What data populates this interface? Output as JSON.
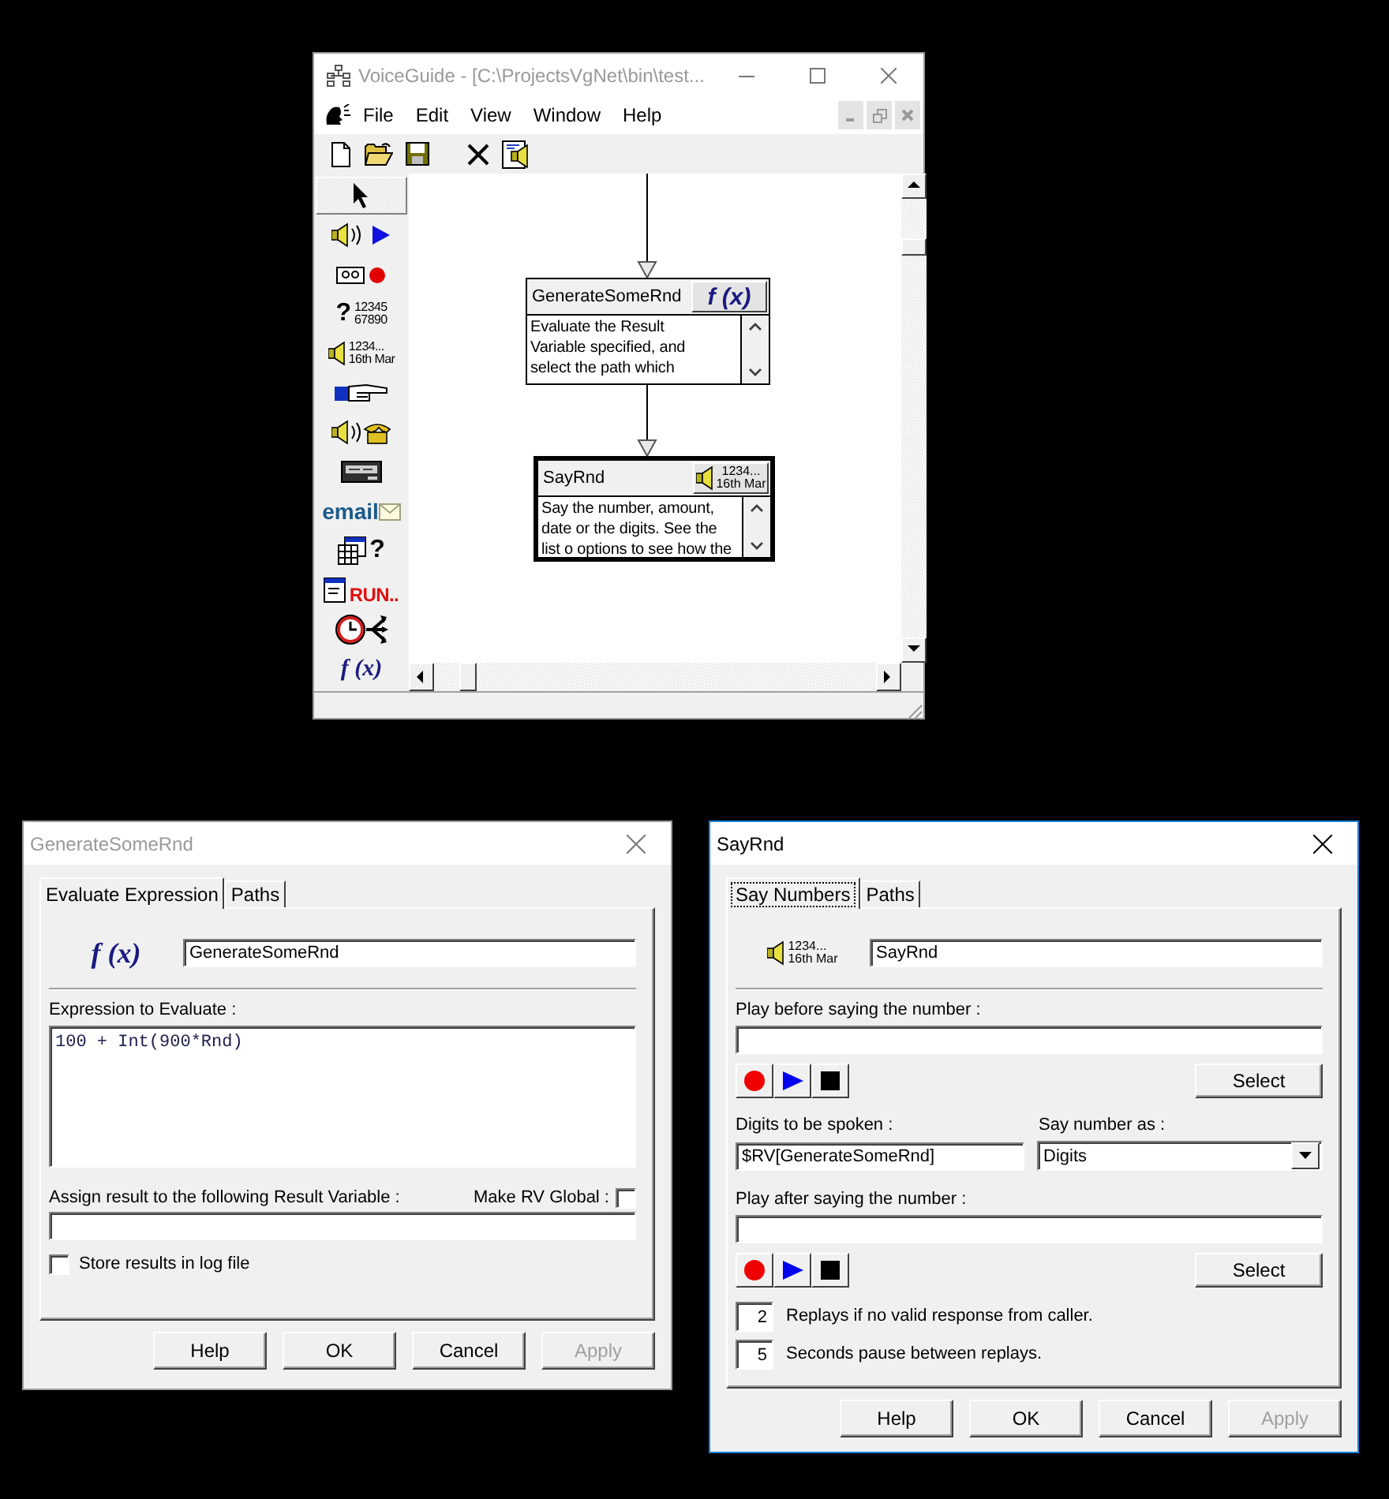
{
  "main_window": {
    "title": "VoiceGuide - [C:\\ProjectsVgNet\\bin\\test...",
    "active": false,
    "menu": [
      "File",
      "Edit",
      "View",
      "Window",
      "Help"
    ],
    "toolbar": [
      {
        "kind": "new"
      },
      {
        "kind": "open"
      },
      {
        "kind": "save"
      },
      {
        "kind": "delete"
      },
      {
        "kind": "properties"
      }
    ],
    "toolbox": [
      {
        "kind": "pointer",
        "selected": true
      },
      {
        "kind": "play",
        "selected": false
      },
      {
        "kind": "record",
        "selected": false
      },
      {
        "kind": "get_number",
        "symbol": "?",
        "lines": [
          "12345",
          "67890"
        ],
        "selected": false
      },
      {
        "kind": "say_number",
        "lines": [
          "1234...",
          "16th Mar"
        ],
        "selected": false
      },
      {
        "kind": "transfer",
        "selected": false
      },
      {
        "kind": "voicemail",
        "selected": false
      },
      {
        "kind": "pager",
        "selected": false
      },
      {
        "kind": "email",
        "lines": [
          "email"
        ],
        "selected": false
      },
      {
        "kind": "database",
        "symbol": "?",
        "selected": false
      },
      {
        "kind": "run",
        "lines": [
          "RUN.."
        ],
        "selected": false
      },
      {
        "kind": "time_switch",
        "selected": false
      },
      {
        "kind": "expression",
        "lines": [
          "f (x)"
        ],
        "selected": false
      }
    ],
    "nodes": [
      {
        "kind": "expression",
        "title": "GenerateSomeRnd",
        "icon_lines": [
          "f (x)"
        ],
        "description": [
          "Evaluate the Result",
          "Variable specified, and",
          "select the path which"
        ],
        "selected": false
      },
      {
        "kind": "say_number",
        "title": "SayRnd",
        "icon_lines": [
          "1234...",
          "16th Mar"
        ],
        "description": [
          "Say the number, amount,",
          "date or the digits. See the",
          "list o options to see how the"
        ],
        "selected": true
      }
    ]
  },
  "dialogs": [
    {
      "kind": "expression",
      "title": "GenerateSomeRnd",
      "active": false,
      "tabs": [
        {
          "label": "Evaluate Expression",
          "selected": true,
          "focused": false
        },
        {
          "label": "Paths",
          "selected": false,
          "focused": false
        }
      ],
      "icon_text": "f (x)",
      "name_value": "GenerateSomeRnd",
      "expression_label": "Expression to Evaluate :",
      "expression": "100 + Int(900*Rnd)",
      "result_label": "Assign result to the following Result Variable :",
      "global_label": "Make RV Global :",
      "global_checked": false,
      "log_label": "Store results in log file",
      "log_checked": false,
      "buttons": [
        {
          "label": "Help",
          "disabled": false
        },
        {
          "label": "OK",
          "disabled": false
        },
        {
          "label": "Cancel",
          "disabled": false
        },
        {
          "label": "Apply",
          "disabled": true
        }
      ]
    },
    {
      "kind": "say_number",
      "title": "SayRnd",
      "active": true,
      "tabs": [
        {
          "label": "Say Numbers",
          "selected": true,
          "focused": true
        },
        {
          "label": "Paths",
          "selected": false,
          "focused": false
        }
      ],
      "icon_lines": [
        "1234...",
        "16th Mar"
      ],
      "name_value": "SayRnd",
      "before_label": "Play before saying the number :",
      "before_select": "Select",
      "digits_label": "Digits to be spoken :",
      "digits_value": "$RV[GenerateSomeRnd]",
      "say_as_label": "Say number as :",
      "say_as_value": "Digits",
      "after_label": "Play after saying the number :",
      "after_select": "Select",
      "replays_value": "2",
      "replays_label": "Replays if no valid response from caller.",
      "pause_value": "5",
      "pause_label": "Seconds pause between replays.",
      "buttons": [
        {
          "label": "Help",
          "disabled": false
        },
        {
          "label": "OK",
          "disabled": false
        },
        {
          "label": "Cancel",
          "disabled": false
        },
        {
          "label": "Apply",
          "disabled": true
        }
      ]
    }
  ]
}
